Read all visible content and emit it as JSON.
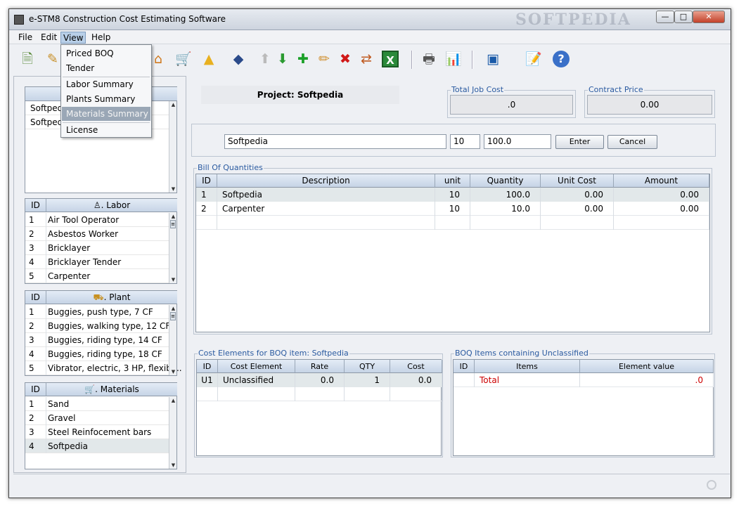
{
  "window": {
    "title": "e-STM8 Construction Cost Estimating Software",
    "watermark": "SOFTPEDIA"
  },
  "menubar": [
    "File",
    "Edit",
    "View",
    "Help"
  ],
  "view_menu": {
    "items": [
      "Priced BOQ",
      "Tender",
      "Labor Summary",
      "Plants Summary",
      "Materials Summary",
      "License"
    ],
    "highlighted": "Materials Summary"
  },
  "left": {
    "projects": {
      "items": [
        "Softped",
        "Softped"
      ]
    },
    "labor": {
      "id_header": "ID",
      "title": ". Labor",
      "rows": [
        [
          "1",
          "Air Tool Operator"
        ],
        [
          "2",
          "Asbestos Worker"
        ],
        [
          "3",
          "Bricklayer"
        ],
        [
          "4",
          "Bricklayer Tender"
        ],
        [
          "5",
          "Carpenter"
        ]
      ]
    },
    "plant": {
      "id_header": "ID",
      "title": ". Plant",
      "rows": [
        [
          "1",
          "Buggies, push type, 7 CF"
        ],
        [
          "2",
          "Buggies, walking type, 12 CF"
        ],
        [
          "3",
          "Buggies, riding type, 14 CF"
        ],
        [
          "4",
          "Buggies, riding type, 18 CF"
        ],
        [
          "5",
          "Vibrator, electric, 3 HP, flexibl..."
        ]
      ]
    },
    "materials": {
      "id_header": "ID",
      "title": ". Materials",
      "rows": [
        [
          "1",
          "Sand"
        ],
        [
          "2",
          "Gravel"
        ],
        [
          "3",
          "Steel Reinfocement bars"
        ],
        [
          "4",
          "Softpedia"
        ]
      ]
    }
  },
  "project": {
    "label": "Project: Softpedia"
  },
  "totals": {
    "job_cost_label": "Total Job Cost",
    "job_cost_value": ".0",
    "contract_label": "Contract Price",
    "contract_value": "0.00"
  },
  "entry": {
    "name": "Softpedia",
    "unit": "10",
    "qty": "100.0",
    "enter": "Enter",
    "cancel": "Cancel"
  },
  "boq": {
    "title": "Bill Of Quantities",
    "headers": [
      "ID",
      "Description",
      "unit",
      "Quantity",
      "Unit Cost",
      "Amount"
    ],
    "rows": [
      [
        "1",
        "Softpedia",
        "10",
        "100.0",
        "0.00",
        "0.00"
      ],
      [
        "2",
        "Carpenter",
        "10",
        "10.0",
        "0.00",
        "0.00"
      ]
    ]
  },
  "cost_elements": {
    "title": "Cost Elements for BOQ item: Softpedia",
    "headers": [
      "ID",
      "Cost Element",
      "Rate",
      "QTY",
      "Cost"
    ],
    "rows": [
      [
        "U1",
        "Unclassified",
        "0.0",
        "1",
        "0.0"
      ]
    ]
  },
  "boq_items": {
    "title": "BOQ Items containing  Unclassified",
    "headers": [
      "ID",
      "Items",
      "Element value"
    ],
    "rows": [
      [
        "",
        "Total",
        ".0"
      ]
    ],
    "total_color": "#cc0000"
  }
}
